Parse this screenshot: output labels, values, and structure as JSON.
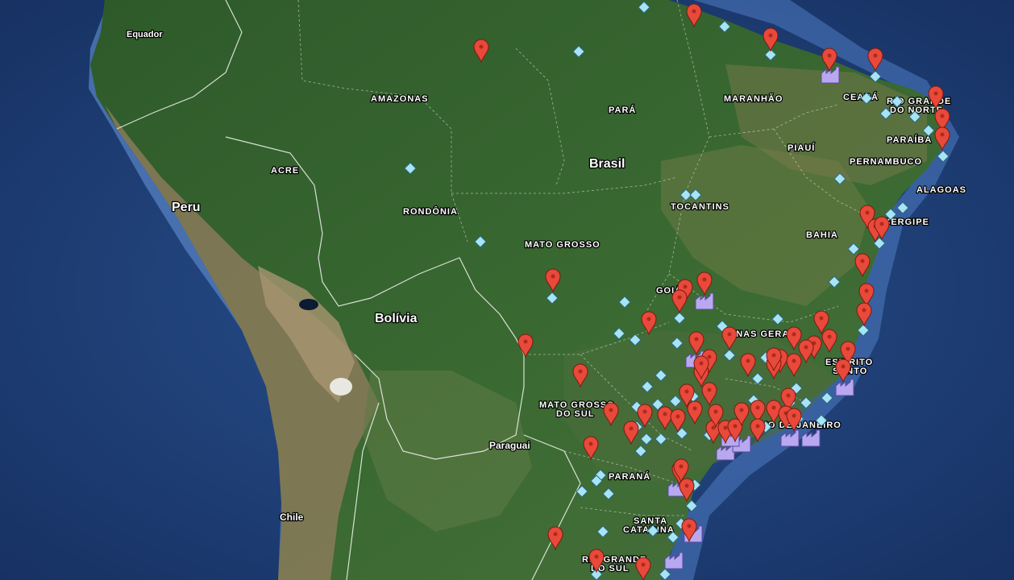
{
  "labels": {
    "equador": "Equador",
    "peru": "Peru",
    "brasil": "Brasil",
    "bolivia": "Bolívia",
    "paraguai": "Paraguai",
    "chile": "Chile",
    "amazonas": "AMAZONAS",
    "para": "PARÁ",
    "maranhao": "MARANHÃO",
    "ceara": "CEARÁ",
    "rn1": "RIO GRANDE",
    "rn2": "DO NORTE",
    "paraiba": "PARAÍBA",
    "piaui": "PIAUÍ",
    "pernambuco": "PERNAMBUCO",
    "alagoas": "ALAGOAS",
    "sergipe": "SERGIPE",
    "acre": "ACRE",
    "rondonia": "RONDÔNIA",
    "tocantins": "TOCANTINS",
    "bahia": "BAHIA",
    "mato_grosso": "MATO GROSSO",
    "goias": "GOIÁS",
    "minas": "MINAS GERAIS",
    "es1": "ESPÍRITO",
    "es2": "SANTO",
    "ms1": "MATO GROSSO",
    "ms2": "DO SUL",
    "rj": "RIO DE JANEIRO",
    "parana": "PARANÁ",
    "sc1": "SANTA",
    "sc2": "CATARINA",
    "rs1": "RIO GRANDE",
    "rs2": "DO SUL"
  },
  "colors": {
    "ocean": "#1f3f7a",
    "forest": "#2f5a2c",
    "pin": "#e8493a",
    "diamond": "#a8e4f4",
    "factory": "#b8a8f0"
  },
  "marker_icons": [
    "map-pin-icon",
    "diamond-marker-icon",
    "factory-icon"
  ]
}
